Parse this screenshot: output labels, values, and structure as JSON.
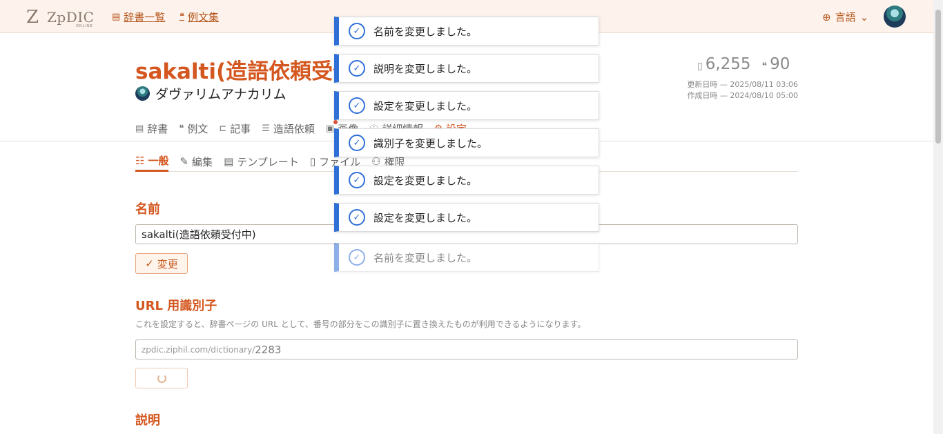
{
  "header": {
    "logo_text": "ZpDIC",
    "logo_sub": "ONLINE",
    "links": [
      {
        "icon": "dictionary-list-icon",
        "label": "辞書一覧"
      },
      {
        "icon": "quote-icon",
        "label": "例文集"
      }
    ],
    "language_label": "言語"
  },
  "dictionary": {
    "title": "sakalti(造語依頼受付中)",
    "owner": "ダヴァリムアナカリム",
    "word_count": "6,255",
    "example_count": "90",
    "updated": "更新日時 — 2025/08/11 03:06",
    "created": "作成日時 — 2024/08/10 05:00"
  },
  "tabs": [
    {
      "icon": "book-icon",
      "label": "辞書"
    },
    {
      "icon": "quote-icon",
      "label": "例文"
    },
    {
      "icon": "article-icon",
      "label": "記事"
    },
    {
      "icon": "list-icon",
      "label": "造語依頼"
    },
    {
      "icon": "image-icon",
      "label": "画像"
    },
    {
      "icon": "info-icon",
      "label": "詳細情報"
    },
    {
      "icon": "gear-icon",
      "label": "設定"
    }
  ],
  "subtabs": [
    {
      "icon": "sliders-icon",
      "label": "一般"
    },
    {
      "icon": "pencil-icon",
      "label": "編集"
    },
    {
      "icon": "template-icon",
      "label": "テンプレート"
    },
    {
      "icon": "file-icon",
      "label": "ファイル"
    },
    {
      "icon": "people-icon",
      "label": "権限"
    }
  ],
  "settings": {
    "name_heading": "名前",
    "name_value": "sakalti(造語依頼受付中)",
    "change_label": "変更",
    "url_heading": "URL 用識別子",
    "url_description": "これを設定すると、辞書ページの URL として、番号の部分をこの識別子に置き換えたものが利用できるようになります。",
    "url_prefix": "zpdic.ziphil.com/dictionary/",
    "url_value": "2283",
    "desc_heading": "説明"
  },
  "toasts": [
    "名前を変更しました。",
    "説明を変更しました。",
    "設定を変更しました。",
    "識別子を変更しました。",
    "設定を変更しました。",
    "設定を変更しました。",
    "名前を変更しました。"
  ]
}
